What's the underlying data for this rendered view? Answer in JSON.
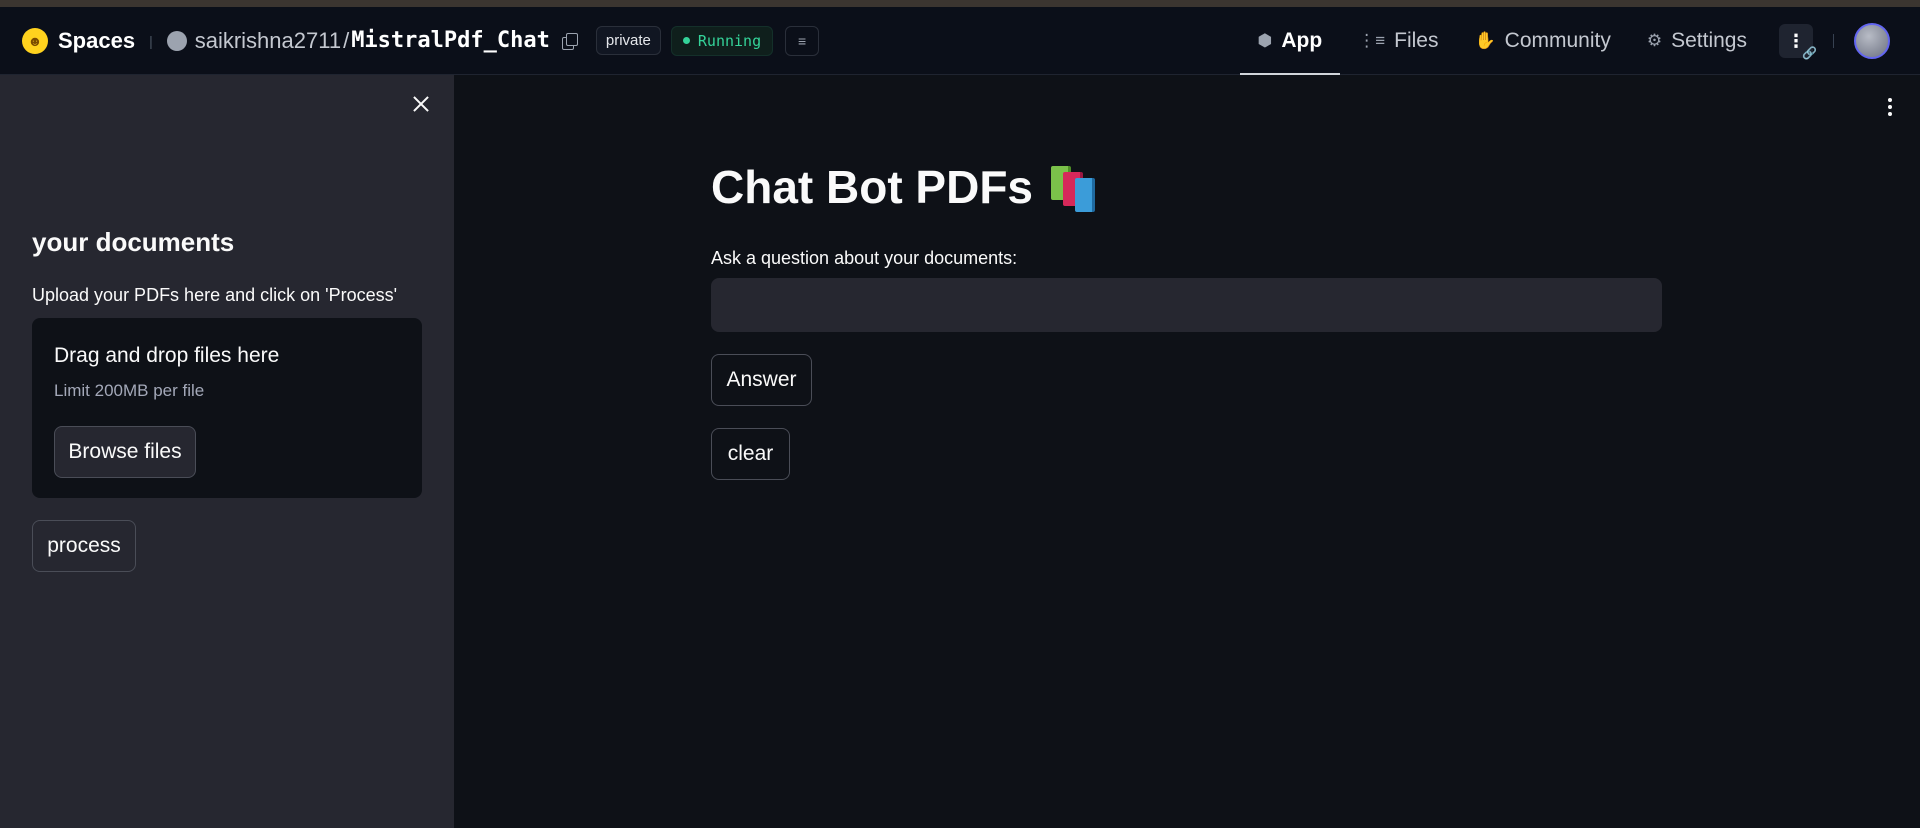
{
  "header": {
    "brand": "Spaces",
    "owner": "saikrishna2711",
    "separator": "/",
    "repo": "MistralPdf_Chat",
    "visibility": "private",
    "status": "Running",
    "nav": [
      {
        "label": "App",
        "icon": "cube-icon",
        "active": true
      },
      {
        "label": "Files",
        "icon": "files-icon",
        "active": false
      },
      {
        "label": "Community",
        "icon": "community-icon",
        "active": false
      },
      {
        "label": "Settings",
        "icon": "gear-icon",
        "active": false
      }
    ],
    "status_color": "#34d399"
  },
  "sidebar": {
    "title": "your documents",
    "upload_label": "Upload your PDFs here and click on 'Process'",
    "dropzone_title": "Drag and drop files here",
    "dropzone_limit": "Limit 200MB per file",
    "browse_label": "Browse files",
    "process_label": "process"
  },
  "main": {
    "title": "Chat Bot PDFs",
    "title_emoji": "books-icon",
    "question_label": "Ask a question about your documents:",
    "question_value": "",
    "answer_label": "Answer",
    "clear_label": "clear"
  }
}
